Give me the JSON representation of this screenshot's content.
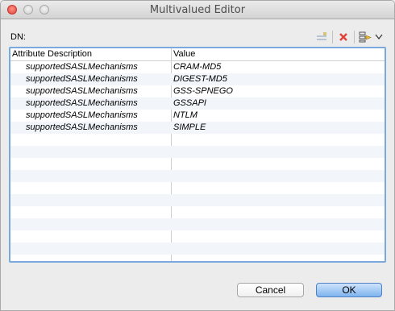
{
  "window": {
    "title": "Multivalued Editor"
  },
  "dn": {
    "label": "DN:"
  },
  "toolbar": {
    "icons": [
      "new-value-icon",
      "delete-icon",
      "add-filter-icon",
      "chevron-down-icon"
    ]
  },
  "table": {
    "headers": [
      "Attribute Description",
      "Value"
    ],
    "rows": [
      {
        "attribute": "supportedSASLMechanisms",
        "value": "CRAM-MD5"
      },
      {
        "attribute": "supportedSASLMechanisms",
        "value": "DIGEST-MD5"
      },
      {
        "attribute": "supportedSASLMechanisms",
        "value": "GSS-SPNEGO"
      },
      {
        "attribute": "supportedSASLMechanisms",
        "value": "GSSAPI"
      },
      {
        "attribute": "supportedSASLMechanisms",
        "value": "NTLM"
      },
      {
        "attribute": "supportedSASLMechanisms",
        "value": "SIMPLE"
      }
    ]
  },
  "buttons": {
    "cancel": "Cancel",
    "ok": "OK"
  },
  "colors": {
    "selection_border": "#7aa9dd",
    "ok_button": "#7fb3ef",
    "delete_icon": "#e0443a"
  }
}
